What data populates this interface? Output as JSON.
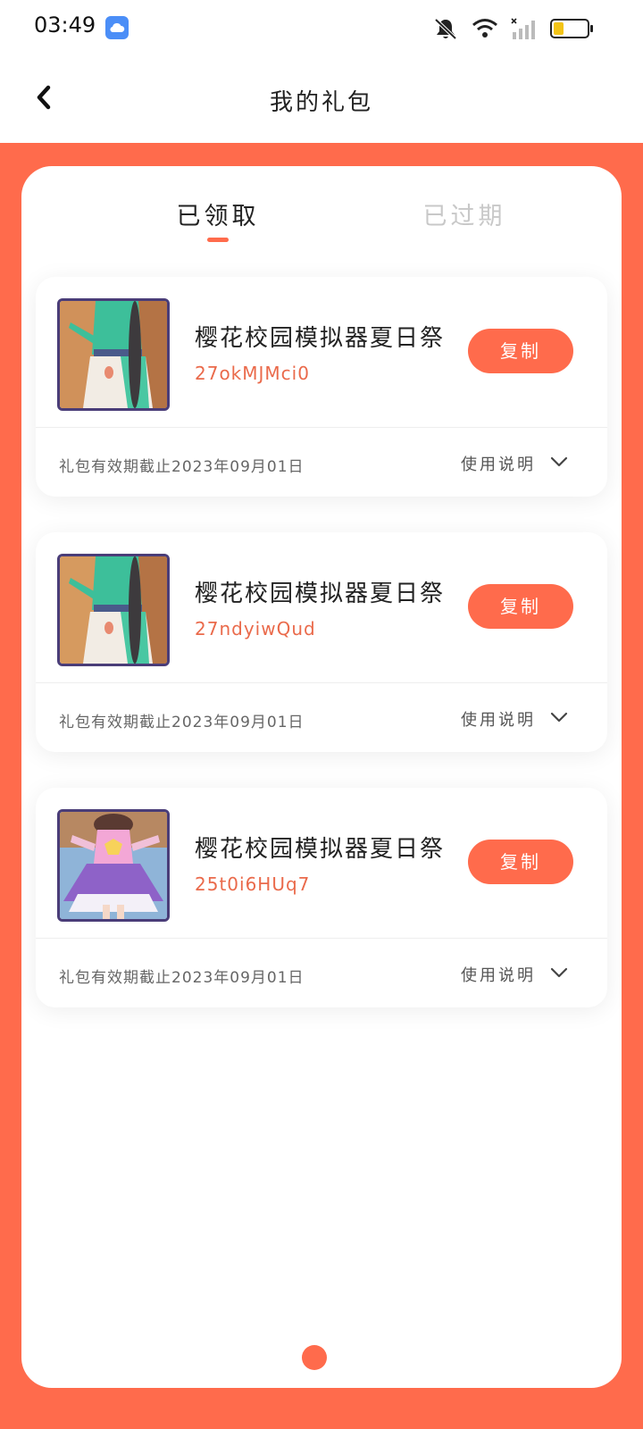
{
  "status_bar": {
    "time": "03:49",
    "battery_level": 0.3,
    "icons": [
      "cloud-app-icon",
      "mute-icon",
      "wifi-icon",
      "signal-icon",
      "battery-icon"
    ]
  },
  "header": {
    "title": "我的礼包",
    "back_icon": "chevron-left-icon"
  },
  "tabs": [
    {
      "label": "已领取",
      "active": true
    },
    {
      "label": "已过期",
      "active": false
    }
  ],
  "gifts": [
    {
      "game_name": "樱花校园模拟器夏日祭",
      "code": "27okMJMci0",
      "copy_label": "复制",
      "validity": "礼包有效期截止2023年09月01日",
      "usage_label": "使用说明"
    },
    {
      "game_name": "樱花校园模拟器夏日祭",
      "code": "27ndyiwQud",
      "copy_label": "复制",
      "validity": "礼包有效期截止2023年09月01日",
      "usage_label": "使用说明"
    },
    {
      "game_name": "樱花校园模拟器夏日祭",
      "code": "25t0i6HUq7",
      "copy_label": "复制",
      "validity": "礼包有效期截止2023年09月01日",
      "usage_label": "使用说明"
    }
  ],
  "colors": {
    "accent": "#ff6b4c",
    "code_text": "#ea6a4b",
    "inactive_tab": "#c8c8c8"
  }
}
